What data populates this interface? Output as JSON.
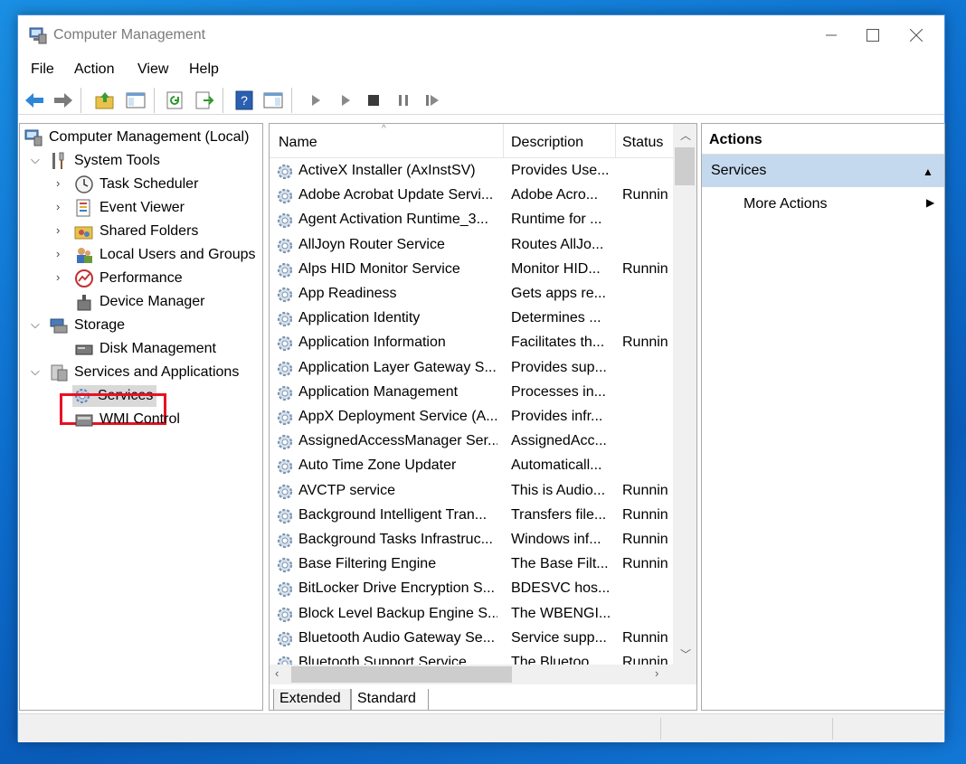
{
  "window": {
    "title": "Computer Management"
  },
  "menu": [
    "File",
    "Action",
    "View",
    "Help"
  ],
  "toolbar": {
    "icons": [
      "back-icon",
      "forward-icon",
      "up-folder-icon",
      "show-hide-tree-icon",
      "refresh-icon",
      "export-list-icon",
      "help-icon",
      "properties-icon",
      "start-service-icon",
      "start-service-alt-icon",
      "stop-service-icon",
      "pause-service-icon",
      "resume-service-icon"
    ]
  },
  "tree": {
    "root": "Computer Management (Local)",
    "system_tools": "System Tools",
    "task_scheduler": "Task Scheduler",
    "event_viewer": "Event Viewer",
    "shared_folders": "Shared Folders",
    "local_users": "Local Users and Groups",
    "performance": "Performance",
    "device_manager": "Device Manager",
    "storage": "Storage",
    "disk_management": "Disk Management",
    "services_apps": "Services and Applications",
    "services": "Services",
    "wmi_control": "WMI Control"
  },
  "list": {
    "columns": {
      "name": "Name",
      "description": "Description",
      "status": "Status"
    },
    "rows": [
      {
        "name": "ActiveX Installer (AxInstSV)",
        "description": "Provides Use...",
        "status": ""
      },
      {
        "name": "Adobe Acrobat Update Servi...",
        "description": "Adobe Acro...",
        "status": "Runnin"
      },
      {
        "name": "Agent Activation Runtime_3...",
        "description": "Runtime for ...",
        "status": ""
      },
      {
        "name": "AllJoyn Router Service",
        "description": "Routes AllJo...",
        "status": ""
      },
      {
        "name": "Alps HID Monitor Service",
        "description": "Monitor HID...",
        "status": "Runnin"
      },
      {
        "name": "App Readiness",
        "description": "Gets apps re...",
        "status": ""
      },
      {
        "name": "Application Identity",
        "description": "Determines ...",
        "status": ""
      },
      {
        "name": "Application Information",
        "description": "Facilitates th...",
        "status": "Runnin"
      },
      {
        "name": "Application Layer Gateway S...",
        "description": "Provides sup...",
        "status": ""
      },
      {
        "name": "Application Management",
        "description": "Processes in...",
        "status": ""
      },
      {
        "name": "AppX Deployment Service (A...",
        "description": "Provides infr...",
        "status": ""
      },
      {
        "name": "AssignedAccessManager Ser...",
        "description": "AssignedAcc...",
        "status": ""
      },
      {
        "name": "Auto Time Zone Updater",
        "description": "Automaticall...",
        "status": ""
      },
      {
        "name": "AVCTP service",
        "description": "This is Audio...",
        "status": "Runnin"
      },
      {
        "name": "Background Intelligent Tran...",
        "description": "Transfers file...",
        "status": "Runnin"
      },
      {
        "name": "Background Tasks Infrastruc...",
        "description": "Windows inf...",
        "status": "Runnin"
      },
      {
        "name": "Base Filtering Engine",
        "description": "The Base Filt...",
        "status": "Runnin"
      },
      {
        "name": "BitLocker Drive Encryption S...",
        "description": "BDESVC hos...",
        "status": ""
      },
      {
        "name": "Block Level Backup Engine S...",
        "description": "The WBENGI...",
        "status": ""
      },
      {
        "name": "Bluetooth Audio Gateway Se...",
        "description": "Service supp...",
        "status": "Runnin"
      },
      {
        "name": "Bluetooth Support Service",
        "description": "The Bluetoo...",
        "status": "Runnin"
      }
    ]
  },
  "tabs": {
    "extended": "Extended",
    "standard": "Standard"
  },
  "actions": {
    "title": "Actions",
    "section": "Services",
    "item": "More Actions"
  }
}
